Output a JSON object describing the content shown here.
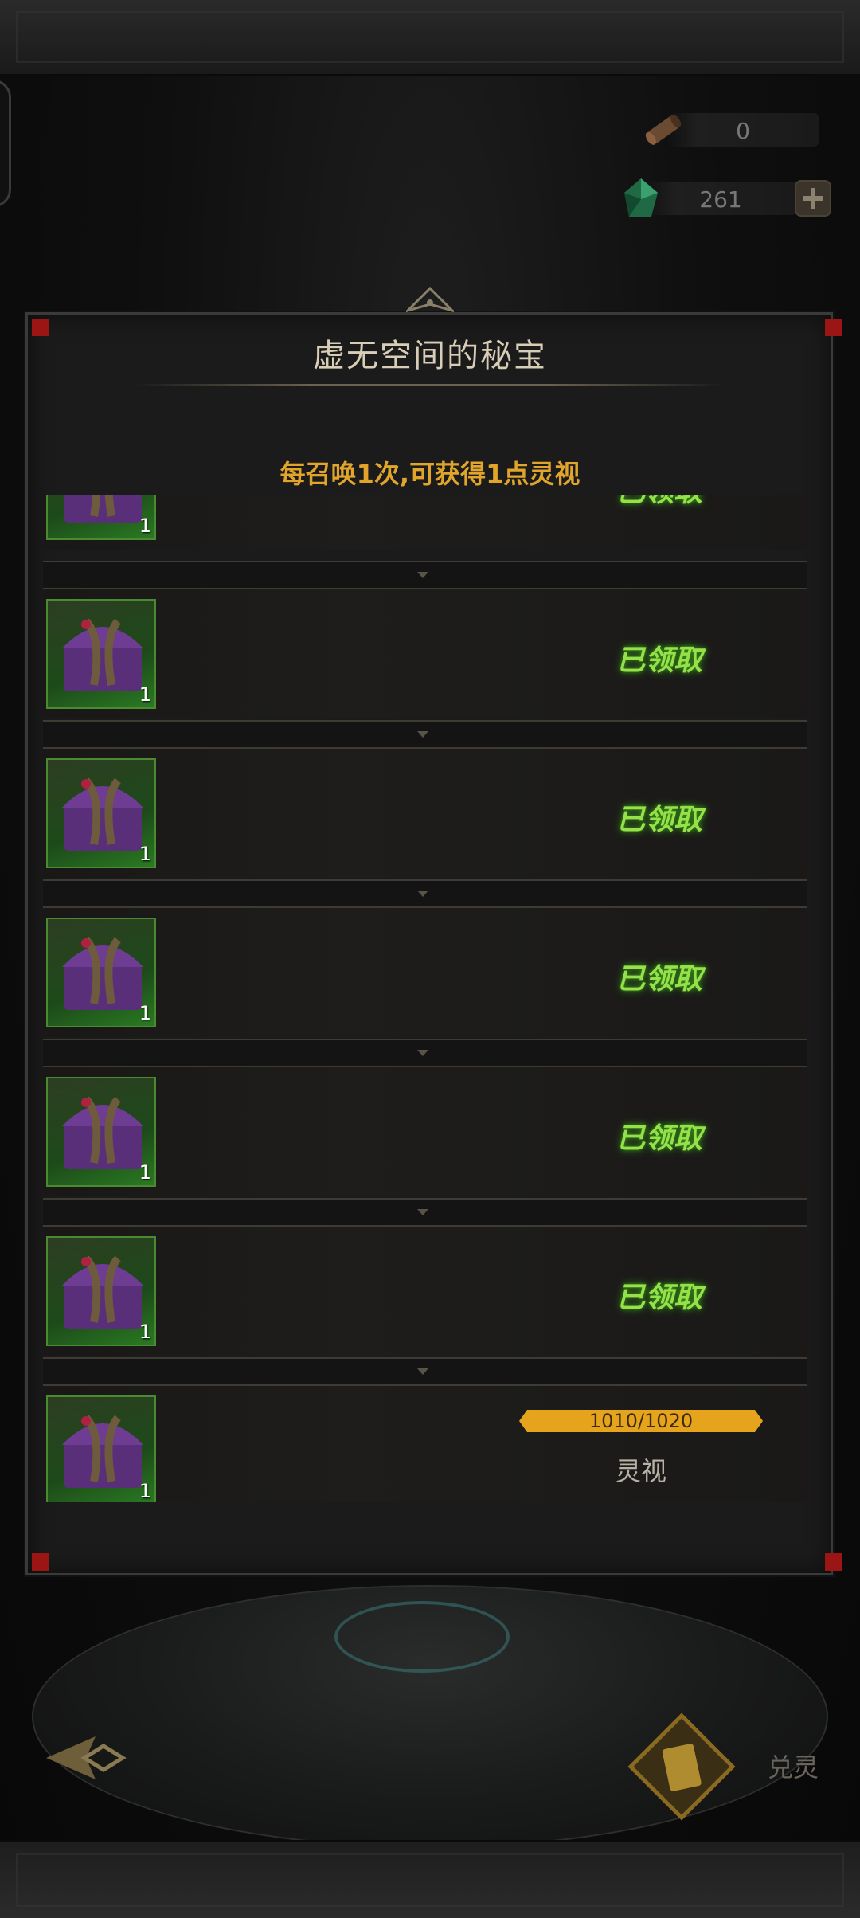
{
  "currency": {
    "scroll": {
      "icon": "scroll-icon",
      "value": "0"
    },
    "gem": {
      "icon": "green-gem-icon",
      "value": "261"
    }
  },
  "panel": {
    "title": "虚无空间的秘宝",
    "subtitle": "每召唤1次,可获得1点灵视"
  },
  "rewards": [
    {
      "icon": "purple-chest-icon",
      "count": "1",
      "status": "已领取"
    },
    {
      "icon": "purple-chest-icon",
      "count": "1",
      "status": "已领取"
    },
    {
      "icon": "purple-chest-icon",
      "count": "1",
      "status": "已领取"
    },
    {
      "icon": "purple-chest-icon",
      "count": "1",
      "status": "已领取"
    },
    {
      "icon": "purple-chest-icon",
      "count": "1",
      "status": "已领取"
    },
    {
      "icon": "purple-chest-icon",
      "count": "1",
      "status": "已领取"
    },
    {
      "icon": "purple-chest-icon",
      "count": "1",
      "progress_text": "1010/1020",
      "progress": 0.99,
      "progress_label": "灵视"
    }
  ],
  "bottom": {
    "exchange_label": "兑灵"
  },
  "colors": {
    "claimed": "#96e04a",
    "accent": "#e0a52a",
    "progress_fill": "#e6a31c",
    "slot_green": "#2a7a22"
  }
}
